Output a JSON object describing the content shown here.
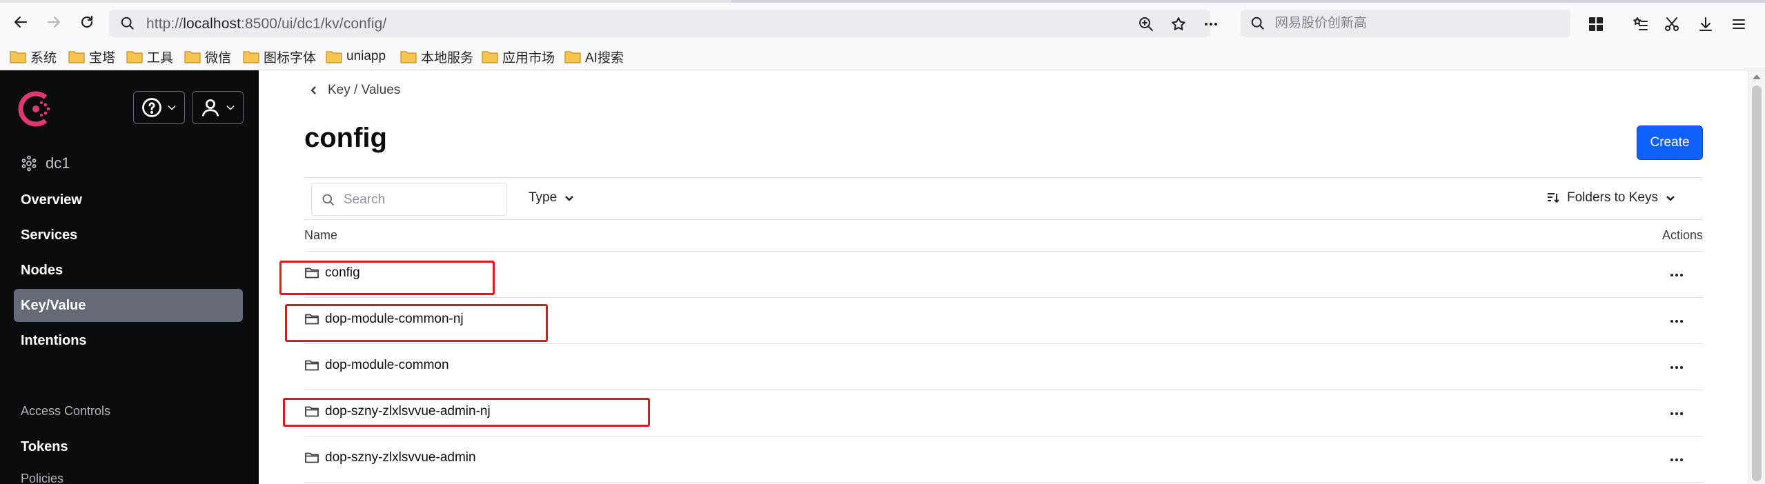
{
  "browser": {
    "url_prefix": "http://",
    "url_host": "localhost",
    "url_rest": ":8500/ui/dc1/kv/config/",
    "search_placeholder": "网易股价创新高",
    "bookmarks": [
      "系统",
      "宝塔",
      "工具",
      "微信",
      "图标字体",
      "uniapp",
      "本地服务",
      "应用市场",
      "AI搜索"
    ]
  },
  "sidebar": {
    "datacenter": "dc1",
    "nav": [
      "Overview",
      "Services",
      "Nodes",
      "Key/Value",
      "Intentions"
    ],
    "active": "Key/Value",
    "section_label": "Access Controls",
    "section_items": [
      "Tokens",
      "Policies"
    ]
  },
  "main": {
    "breadcrumb": "Key / Values",
    "title": "config",
    "create_label": "Create",
    "search_placeholder": "Search",
    "type_filter_label": "Type",
    "sort_label": "Folders to Keys",
    "col_name": "Name",
    "col_actions": "Actions",
    "rows": [
      "config",
      "dop-module-common-nj",
      "dop-module-common",
      "dop-szny-zlxlsvvue-admin-nj",
      "dop-szny-zlxlsvvue-admin"
    ]
  },
  "colors": {
    "accent_blue": "#1060ff",
    "sidebar_bg": "#0b0c0e",
    "active_nav": "#656a76",
    "logo": "#e03875",
    "annotation_red": "#e0161b"
  },
  "icons": {
    "folder_icon": "folder-icon",
    "help_icon": "help-icon",
    "user_icon": "user-icon"
  }
}
